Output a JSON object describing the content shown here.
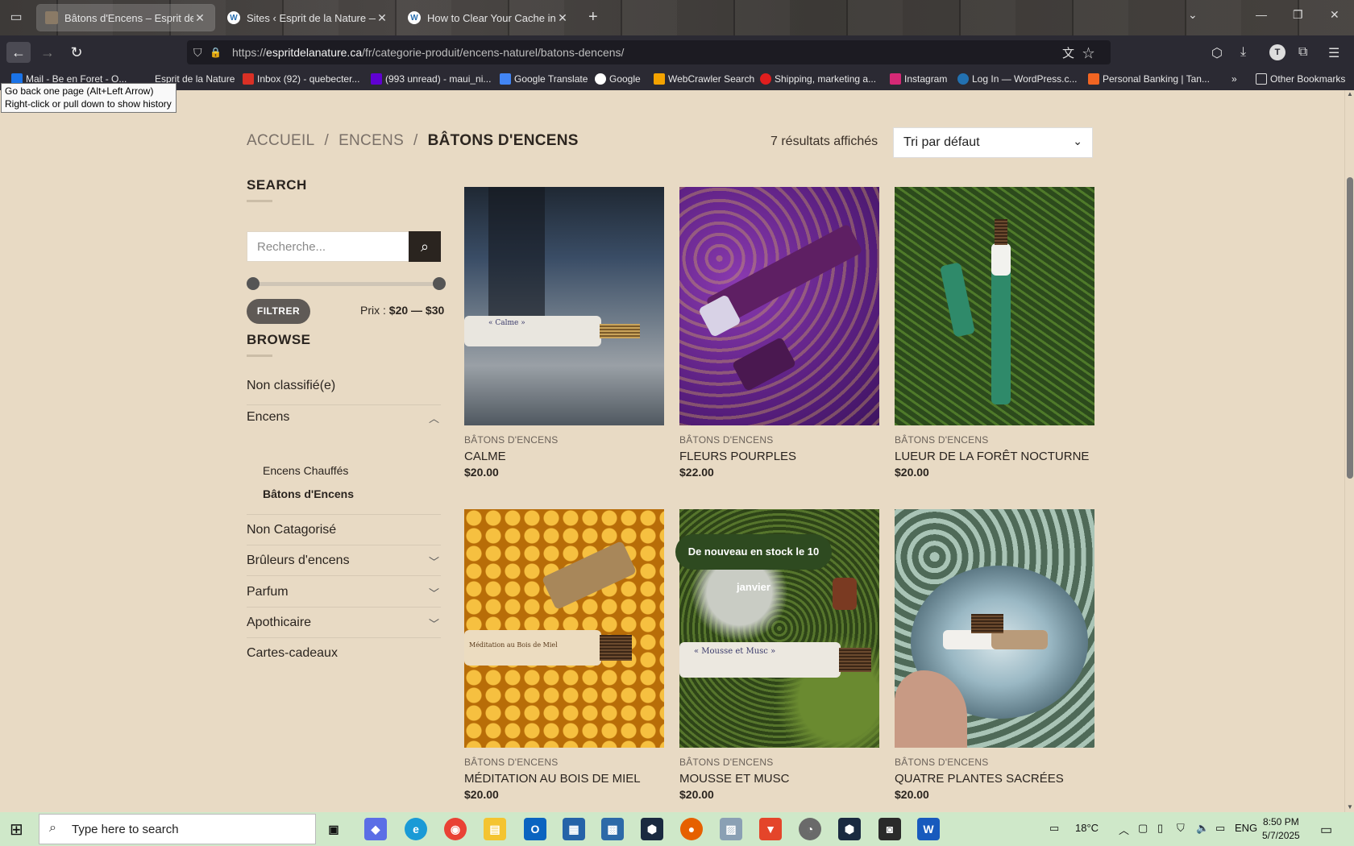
{
  "browser": {
    "tabs": [
      {
        "title": "Bâtons d'Encens – Esprit de la N",
        "active": true
      },
      {
        "title": "Sites ‹ Esprit de la Nature — W",
        "active": false
      },
      {
        "title": "How to Clear Your Cache in W",
        "active": false
      }
    ],
    "url_prefix": "https://",
    "url_host": "espritdelanature.ca",
    "url_path": "/fr/categorie-produit/encens-naturel/batons-dencens/",
    "profile_initial": "T",
    "bookmarks": [
      "Mail - Be en Foret - O...",
      "Esprit de la Nature",
      "Inbox (92) - quebecter...",
      "(993 unread) - maui_ni...",
      "Google Translate",
      "Google",
      "WebCrawler Search",
      "Shipping, marketing a...",
      "Instagram",
      "Log In — WordPress.c...",
      "Personal Banking | Tan..."
    ],
    "other_bookmarks": "Other Bookmarks",
    "tooltip_line1": "Go back one page (Alt+Left Arrow)",
    "tooltip_line2": "Right-click or pull down to show history"
  },
  "page": {
    "breadcrumb": [
      "ACCUEIL",
      "ENCENS",
      "BÂTONS D'ENCENS"
    ],
    "breadcrumb_sep": "/",
    "results_text": "7 résultats affichés",
    "sort_value": "Tri par défaut",
    "sidebar": {
      "search_heading": "SEARCH",
      "search_placeholder": "Recherche...",
      "filter_label": "FILTRER",
      "price_prefix": "Prix :",
      "price_min": "$20",
      "price_dash": "—",
      "price_max": "$30",
      "browse_heading": "BROWSE",
      "categories": [
        {
          "label": "Non classifié(e)"
        },
        {
          "label": "Encens",
          "expanded": true
        },
        {
          "label": "Non Catagorisé"
        },
        {
          "label": "Brûleurs d'encens"
        },
        {
          "label": "Parfum"
        },
        {
          "label": "Apothicaire"
        },
        {
          "label": "Cartes-cadeaux"
        }
      ],
      "subcategories": [
        "Encens Chauffés",
        "Bâtons d'Encens"
      ]
    },
    "products": [
      {
        "category": "BÂTONS D'ENCENS",
        "name": "CALME",
        "price": "$20.00"
      },
      {
        "category": "BÂTONS D'ENCENS",
        "name": "FLEURS POURPLES",
        "price": "$22.00"
      },
      {
        "category": "BÂTONS D'ENCENS",
        "name": "LUEUR DE LA FORÊT NOCTURNE",
        "price": "$20.00"
      },
      {
        "category": "BÂTONS D'ENCENS",
        "name": "MÉDITATION AU BOIS DE MIEL",
        "price": "$20.00"
      },
      {
        "category": "BÂTONS D'ENCENS",
        "name": "MOUSSE ET MUSC",
        "price": "$20.00"
      },
      {
        "category": "BÂTONS D'ENCENS",
        "name": "QUATRE PLANTES SACRÉES",
        "price": "$20.00"
      }
    ],
    "badge": "De nouveau en stock le 10 janvier",
    "label_calme": "« Calme »",
    "label_miel": "Méditation au Bois de Miel",
    "label_mousse": "« Mousse et Musc »"
  },
  "taskbar": {
    "search_placeholder": "Type here to search",
    "temperature": "18°C",
    "language": "ENG",
    "time": "8:50 PM",
    "date": "5/7/2025"
  }
}
